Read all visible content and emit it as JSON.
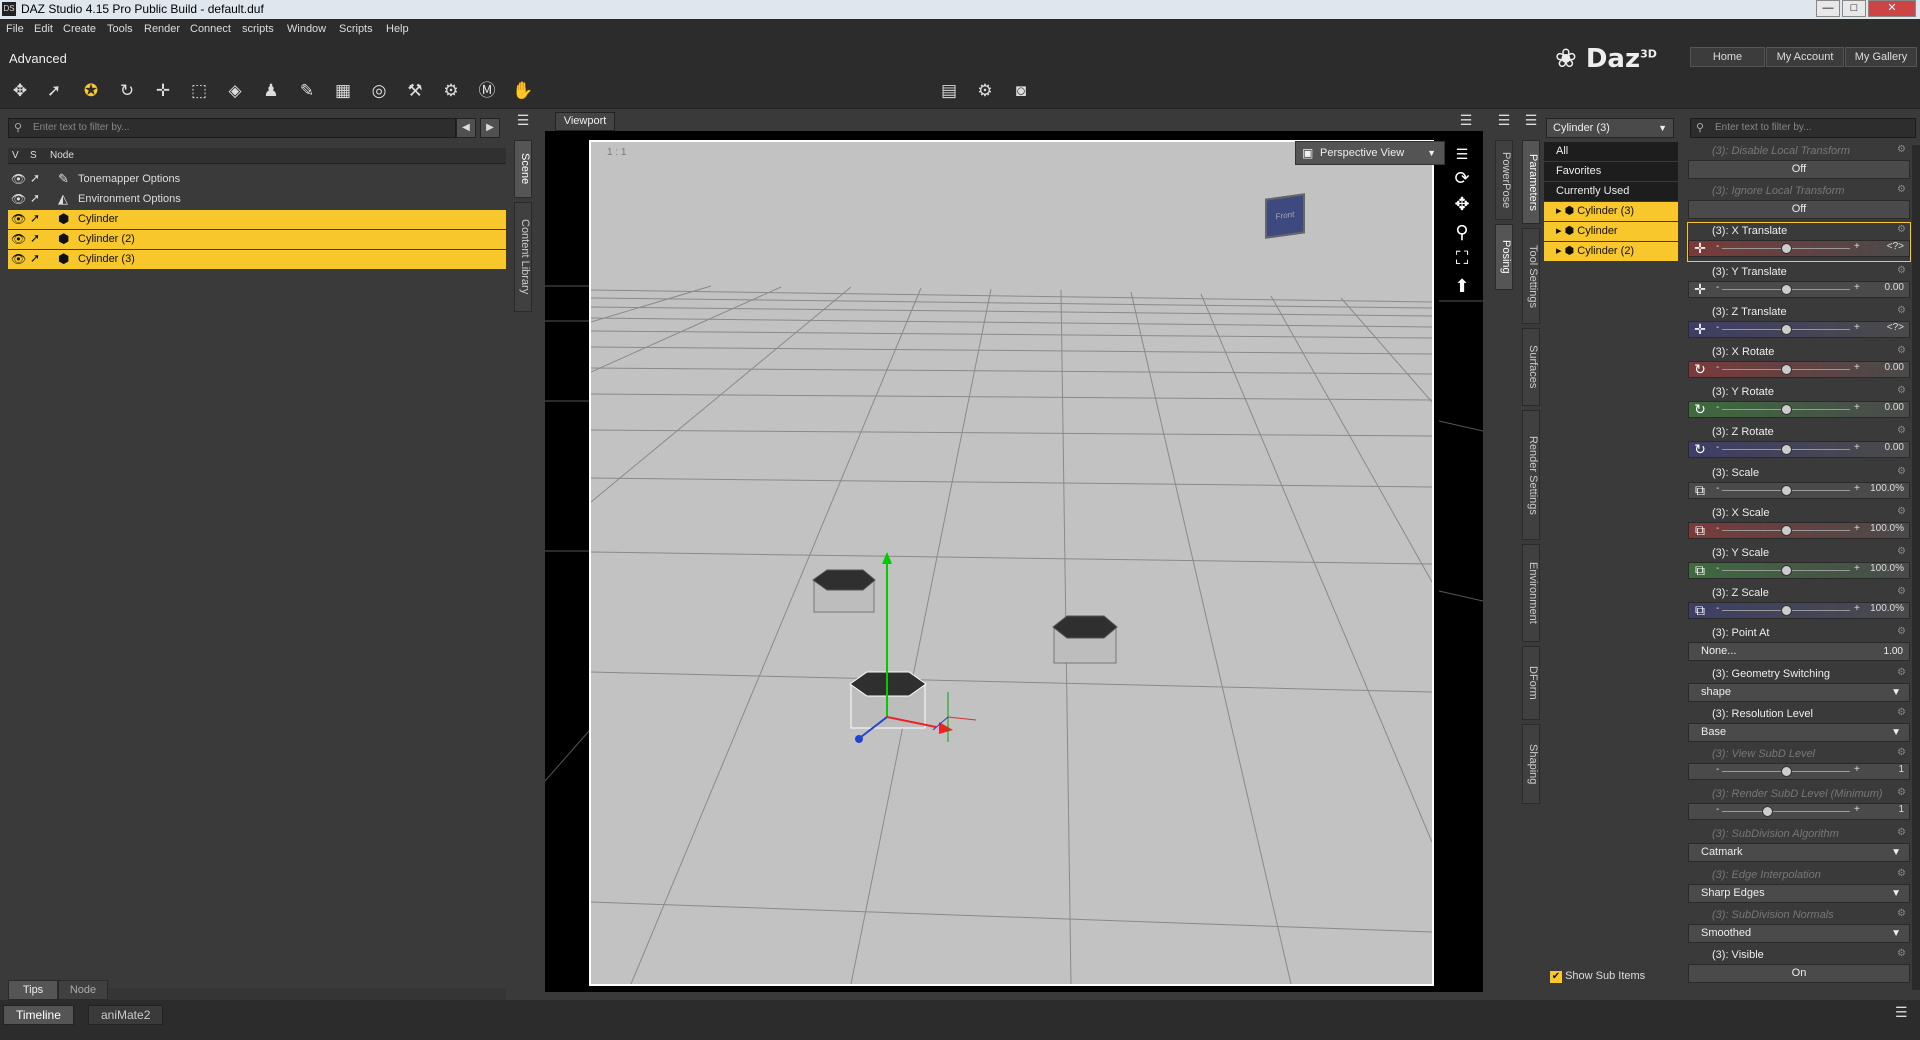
{
  "window": {
    "title": "DAZ Studio 4.15 Pro Public Build - default.duf",
    "app_icon": "DS",
    "minimize": "—",
    "maximize": "□",
    "close": "✕"
  },
  "menu": [
    "File",
    "Edit",
    "Create",
    "Tools",
    "Render",
    "Connect",
    "scripts",
    "Window",
    "Scripts",
    "Help"
  ],
  "header": {
    "layout": "Advanced",
    "logo": "Daz",
    "logo_sup": "3D",
    "buttons": [
      "Home",
      "My Account",
      "My Gallery"
    ]
  },
  "scene_pane": {
    "filter_placeholder": "Enter text to filter by...",
    "col_v": "V",
    "col_s": "S",
    "col_node": "Node",
    "nodes": [
      {
        "label": "Tonemapper Options",
        "selected": false
      },
      {
        "label": "Environment Options",
        "selected": false
      },
      {
        "label": "Cylinder",
        "selected": true
      },
      {
        "label": "Cylinder (2)",
        "selected": true
      },
      {
        "label": "Cylinder (3)",
        "selected": true
      }
    ],
    "side_tabs": [
      "Scene",
      "Content Library"
    ],
    "bottom_tabs": [
      "Tips",
      "Node"
    ]
  },
  "viewport": {
    "tab": "Viewport",
    "view_label": "Perspective View",
    "corner_label": "1 : 1",
    "cube_label": "Front"
  },
  "right_tabs_a": [
    "PowerPose",
    "Posing"
  ],
  "right_tabs_b": [
    "Parameters",
    "Tool Settings",
    "Surfaces",
    "Render Settings",
    "Environment",
    "DForm",
    "Shaping"
  ],
  "params_panel": {
    "node_select": "Cylinder (3)",
    "filter_placeholder": "Enter text to filter by...",
    "categories": [
      {
        "label": "All",
        "style": "hi"
      },
      {
        "label": "Favorites",
        "style": "hi"
      },
      {
        "label": "Currently Used",
        "style": "hi"
      },
      {
        "label": "Cylinder (3)",
        "style": "sel"
      },
      {
        "label": "Cylinder",
        "style": "sel"
      },
      {
        "label": "Cylinder (2)",
        "style": "sel"
      }
    ],
    "show_sub_items": "Show Sub Items",
    "params": [
      {
        "label": "(3): Disable Local Transform",
        "type": "toggle",
        "value": "Off",
        "disabled": true
      },
      {
        "label": "(3): Ignore Local Transform",
        "type": "toggle",
        "value": "Off",
        "disabled": true
      },
      {
        "label": "(3): X Translate",
        "type": "slider",
        "value": "<?>",
        "color": "#7a3a3a",
        "knob": 0.5
      },
      {
        "label": "(3): Y Translate",
        "type": "slider",
        "value": "0.00",
        "color": "#4a4a4a",
        "knob": 0.5
      },
      {
        "label": "(3): Z Translate",
        "type": "slider",
        "value": "<?>",
        "color": "#3e3e66",
        "knob": 0.5
      },
      {
        "label": "(3): X Rotate",
        "type": "slider",
        "value": "0.00",
        "color": "#7a3a3a",
        "knob": 0.5
      },
      {
        "label": "(3): Y Rotate",
        "type": "slider",
        "value": "0.00",
        "color": "#3e6a3e",
        "knob": 0.5
      },
      {
        "label": "(3): Z Rotate",
        "type": "slider",
        "value": "0.00",
        "color": "#3e3e66",
        "knob": 0.5
      },
      {
        "label": "(3): Scale",
        "type": "slider",
        "value": "100.0%",
        "color": "#4a4a4a",
        "knob": 0.5
      },
      {
        "label": "(3): X Scale",
        "type": "slider",
        "value": "100.0%",
        "color": "#7a3a3a",
        "knob": 0.5
      },
      {
        "label": "(3): Y Scale",
        "type": "slider",
        "value": "100.0%",
        "color": "#3e6a3e",
        "knob": 0.5
      },
      {
        "label": "(3): Z Scale",
        "type": "slider",
        "value": "100.0%",
        "color": "#3e3e66",
        "knob": 0.5
      },
      {
        "label": "(3): Point At",
        "type": "pointat",
        "value": "None...",
        "value2": "1.00"
      },
      {
        "label": "(3): Geometry Switching",
        "type": "dropdown",
        "value": "shape"
      },
      {
        "label": "(3): Resolution Level",
        "type": "dropdown",
        "value": "Base"
      },
      {
        "label": "(3): View SubD Level",
        "type": "slider",
        "value": "1",
        "color": "#4a4a4a",
        "knob": 0.5,
        "disabled": true
      },
      {
        "label": "(3): Render SubD Level (Minimum)",
        "type": "slider",
        "value": "1",
        "color": "#4a4a4a",
        "knob": 0.35,
        "disabled": true
      },
      {
        "label": "(3): SubDivision Algorithm",
        "type": "dropdown",
        "value": "Catmark",
        "disabled": true
      },
      {
        "label": "(3): Edge Interpolation",
        "type": "dropdown",
        "value": "Sharp Edges",
        "disabled": true
      },
      {
        "label": "(3): SubDivision Normals",
        "type": "dropdown",
        "value": "Smoothed",
        "disabled": true
      },
      {
        "label": "(3): Visible",
        "type": "toggle",
        "value": "On"
      }
    ]
  },
  "bottom_tabs": [
    "Timeline",
    "aniMate2"
  ]
}
